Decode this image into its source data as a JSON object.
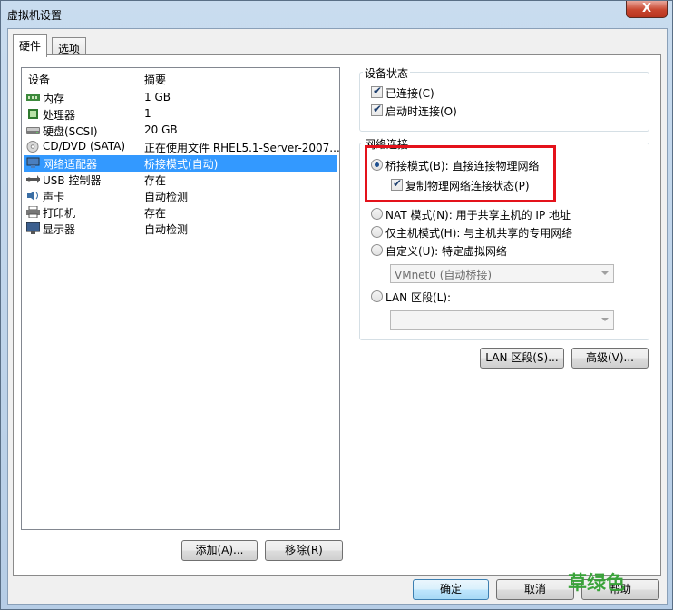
{
  "window": {
    "title": "虚拟机设置",
    "close": "X"
  },
  "tabs": [
    {
      "label": "硬件"
    },
    {
      "label": "选项"
    }
  ],
  "devices": {
    "headers": {
      "device": "设备",
      "summary": "摘要"
    },
    "rows": [
      {
        "name": "内存",
        "summary": "1 GB",
        "icon": "memory-icon"
      },
      {
        "name": "处理器",
        "summary": "1",
        "icon": "processor-icon"
      },
      {
        "name": "硬盘(SCSI)",
        "summary": "20 GB",
        "icon": "hard-disk-icon"
      },
      {
        "name": "CD/DVD (SATA)",
        "summary": "正在使用文件 RHEL5.1-Server-2007...",
        "icon": "cd-dvd-icon"
      },
      {
        "name": "网络适配器",
        "summary": "桥接模式(自动)",
        "icon": "network-adapter-icon",
        "selected": true
      },
      {
        "name": "USB 控制器",
        "summary": "存在",
        "icon": "usb-icon"
      },
      {
        "name": "声卡",
        "summary": "自动检测",
        "icon": "sound-card-icon"
      },
      {
        "name": "打印机",
        "summary": "存在",
        "icon": "printer-icon"
      },
      {
        "name": "显示器",
        "summary": "自动检测",
        "icon": "display-icon"
      }
    ],
    "add_label": "添加(A)...",
    "remove_label": "移除(R)"
  },
  "device_status": {
    "title": "设备状态",
    "connected": {
      "label": "已连接(C)",
      "checked": true
    },
    "connect_at_power_on": {
      "label": "启动时连接(O)",
      "checked": true
    }
  },
  "network": {
    "title": "网络连接",
    "bridged": {
      "label": "桥接模式(B): 直接连接物理网络",
      "selected": true
    },
    "replicate": {
      "label": "复制物理网络连接状态(P)",
      "checked": true
    },
    "nat": {
      "label": "NAT 模式(N): 用于共享主机的 IP 地址",
      "selected": false
    },
    "host_only": {
      "label": "仅主机模式(H): 与主机共享的专用网络",
      "selected": false
    },
    "custom": {
      "label": "自定义(U): 特定虚拟网络",
      "selected": false
    },
    "custom_select": "VMnet0 (自动桥接)",
    "lan_segment": {
      "label": "LAN 区段(L):",
      "selected": false
    },
    "lan_select": "",
    "lan_segments_button": "LAN 区段(S)...",
    "advanced_button": "高级(V)..."
  },
  "footer": {
    "ok": "确定",
    "cancel": "取消",
    "help": "帮助"
  },
  "watermark": "草绿色",
  "colors": {
    "selection": "#3399ff",
    "highlight_box": "#e4121b",
    "watermark": "#3aa33a"
  }
}
